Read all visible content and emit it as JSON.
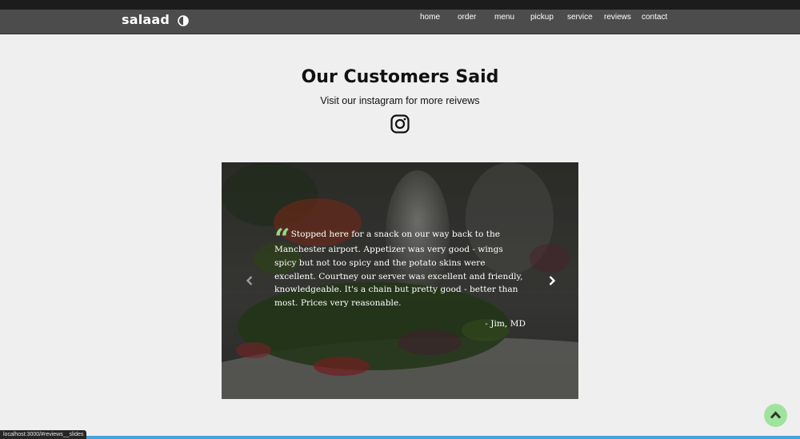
{
  "header": {
    "brand": "salaad",
    "theme_toggle_icon": "half-circle-icon",
    "nav": [
      {
        "label": "home"
      },
      {
        "label": "order"
      },
      {
        "label": "menu"
      },
      {
        "label": "pickup"
      },
      {
        "label": "service"
      },
      {
        "label": "reviews"
      },
      {
        "label": "contact"
      }
    ]
  },
  "reviews": {
    "title": "Our Customers Said",
    "subtitle": "Visit our instagram for more reivews",
    "instagram_icon": "instagram-icon",
    "slide": {
      "quote": "Stopped here for a snack on our way back to the Manchester airport. Appetizer was very good - wings spicy but not too spicy and the potato skins were excellent. Courtney our server was excellent and friendly, knowledgeable. It's a chain but pretty good - better than most. Prices very reasonable.",
      "author": "- Jim, MD"
    },
    "prev_icon": "chevron-left-icon",
    "next_icon": "chevron-right-icon"
  },
  "scroll_top_icon": "chevron-up-icon",
  "status_bar": {
    "url": "localhost:3000/#reviews__slides"
  },
  "colors": {
    "accent_green": "#8fdc8f",
    "navbar": "#4c4c4c",
    "page_bg": "#efefef",
    "bottom_bar": "#47a4df"
  }
}
